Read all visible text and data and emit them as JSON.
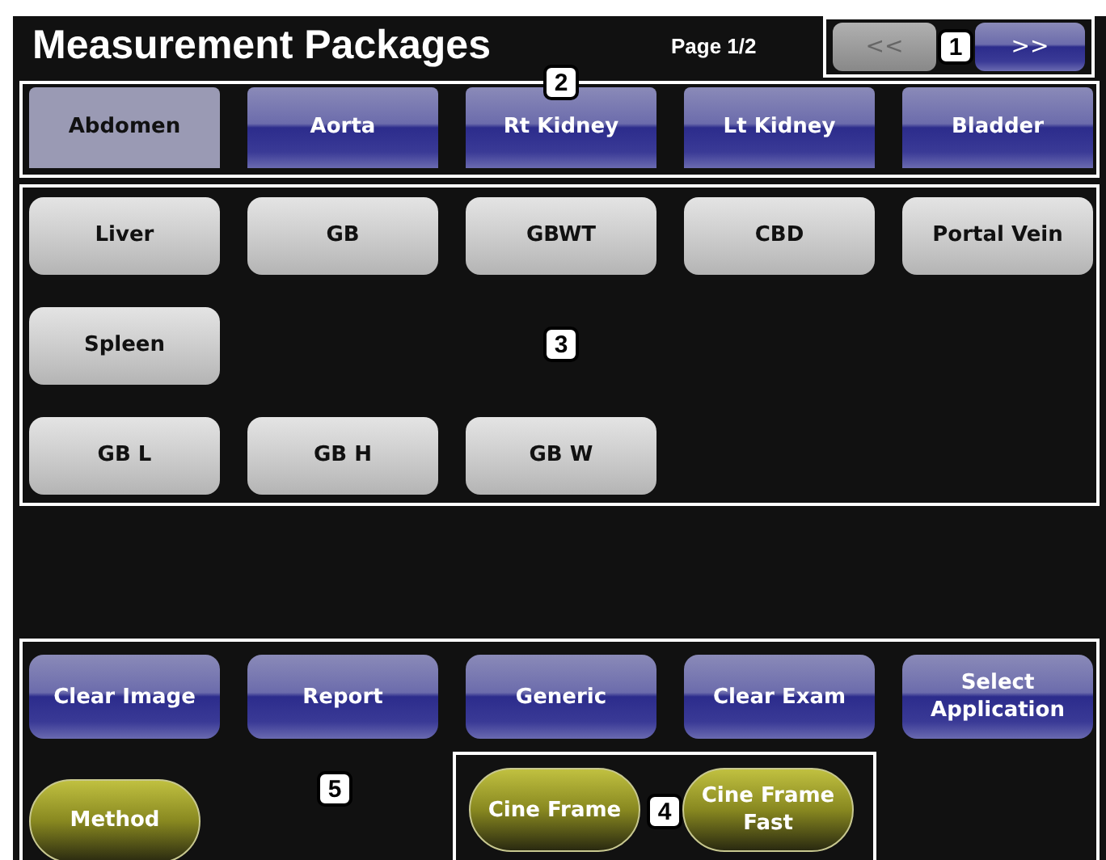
{
  "header": {
    "title": "Measurement Packages",
    "page": "Page 1/2"
  },
  "nav": {
    "callout": "1",
    "buttons": [
      {
        "label": "<<",
        "disabled": true
      },
      {
        "label": ">>",
        "disabled": false
      }
    ]
  },
  "tabs": {
    "callout": "2",
    "items": [
      {
        "label": "Abdomen",
        "selected": true
      },
      {
        "label": "Aorta",
        "selected": false
      },
      {
        "label": "Rt Kidney",
        "selected": false
      },
      {
        "label": "Lt Kidney",
        "selected": false
      },
      {
        "label": "Bladder",
        "selected": false
      }
    ]
  },
  "measurements": {
    "callout": "3",
    "rows": [
      [
        "Liver",
        "GB",
        "GBWT",
        "CBD",
        "Portal Vein"
      ],
      [
        "Spleen"
      ],
      [
        "GB L",
        "GB H",
        "GB W"
      ]
    ]
  },
  "actions": {
    "callout": "5",
    "buttons": [
      "Clear Image",
      "Report",
      "Generic",
      "Clear Exam",
      "Select Application"
    ],
    "method": "Method"
  },
  "cine": {
    "callout": "4",
    "buttons": [
      "Cine Frame",
      "Cine Frame Fast"
    ]
  }
}
